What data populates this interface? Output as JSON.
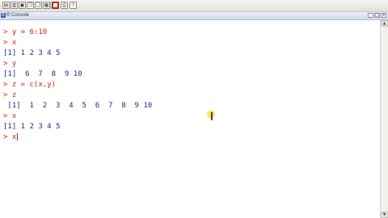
{
  "toolbar": {
    "buttons": [
      {
        "name": "open-script-icon",
        "glyph": "▤"
      },
      {
        "name": "load-workspace-icon",
        "glyph": "▥"
      },
      {
        "name": "save-icon",
        "glyph": "▣"
      },
      {
        "name": "copy-icon",
        "glyph": "❐"
      },
      {
        "name": "paste-icon",
        "glyph": "❑"
      },
      {
        "name": "copy-paste-icon",
        "glyph": "▦"
      },
      {
        "name": "stop-icon",
        "glyph": "■"
      },
      {
        "name": "print-icon",
        "glyph": "⎙"
      },
      {
        "name": "help-icon",
        "glyph": "?"
      }
    ]
  },
  "window": {
    "title": "R Console",
    "icon_glyph": "R",
    "min_glyph": "_",
    "max_glyph": "□",
    "close_glyph": "×"
  },
  "console": {
    "lines": [
      {
        "kind": "input",
        "prompt": ">",
        "text": "y = 6:10"
      },
      {
        "kind": "input",
        "prompt": ">",
        "text": "x"
      },
      {
        "kind": "output",
        "text": "[1] 1 2 3 4 5"
      },
      {
        "kind": "input",
        "prompt": ">",
        "text": "y"
      },
      {
        "kind": "output",
        "text": "[1]  6  7  8  9 10"
      },
      {
        "kind": "input",
        "prompt": ">",
        "text": "z = c(x,y)"
      },
      {
        "kind": "input",
        "prompt": ">",
        "text": "z"
      },
      {
        "kind": "output",
        "text": " [1]  1  2  3  4  5  6  7  8  9 10"
      },
      {
        "kind": "input",
        "prompt": ">",
        "text": "x"
      },
      {
        "kind": "output",
        "text": "[1] 1 2 3 4 5"
      },
      {
        "kind": "current",
        "prompt": ">",
        "text": "x"
      }
    ]
  },
  "colors": {
    "input": "#d1210f",
    "output": "#1f2a8c",
    "cursor_highlight": "#efe55a"
  }
}
